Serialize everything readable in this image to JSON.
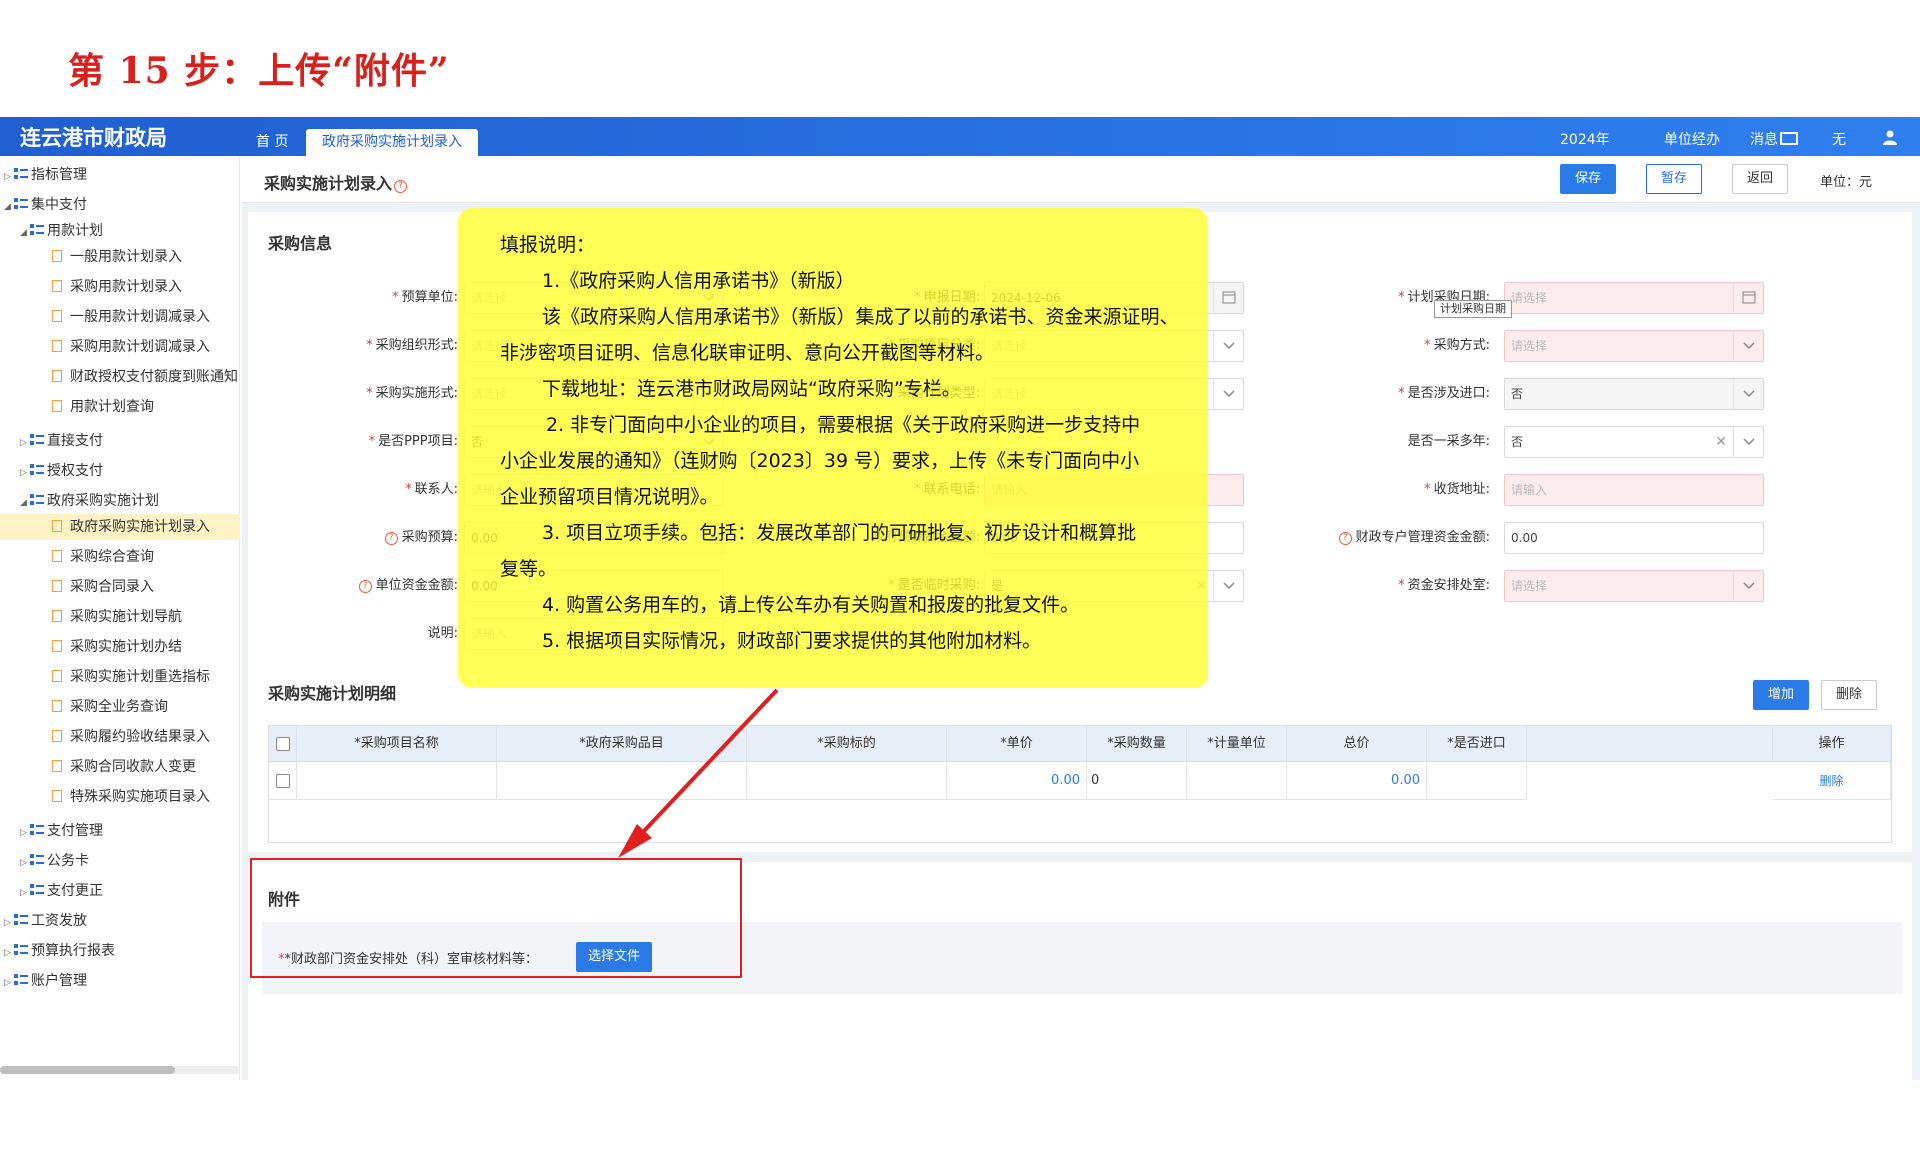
{
  "step_title": "第 15 步：上传“附件”",
  "topbar": {
    "brand": "连云港市财政局",
    "tab_home": "首 页",
    "tab_active": "政府采购实施计划录入",
    "year": "2024年",
    "role": "单位经办",
    "msg": "消息",
    "none": "无"
  },
  "sidebar": {
    "items": [
      "指标管理",
      "集中支付",
      "用款计划",
      "一般用款计划录入",
      "采购用款计划录入",
      "一般用款计划调减录入",
      "采购用款计划调减录入",
      "财政授权支付额度到账通知",
      "用款计划查询",
      "直接支付",
      "授权支付",
      "政府采购实施计划",
      "政府采购实施计划录入",
      "采购综合查询",
      "采购合同录入",
      "采购实施计划导航",
      "采购实施计划办结",
      "采购实施计划重选指标",
      "采购全业务查询",
      "采购履约验收结果录入",
      "采购合同收款人变更",
      "特殊采购实施项目录入",
      "支付管理",
      "公务卡",
      "支付更正",
      "工资发放",
      "预算执行报表",
      "账户管理"
    ]
  },
  "page": {
    "title": "采购实施计划录入",
    "btn_save": "保存",
    "btn_temp": "暂存",
    "btn_back": "返回",
    "unit": "单位：元"
  },
  "info": {
    "title": "采购信息",
    "labels": {
      "budget_unit": "预算单位:",
      "report_date": "申报日期:",
      "plan_date": "计划采购日期:",
      "org_form": "采购组织形式:",
      "item_type": "采购项目分类:",
      "method": "采购方式:",
      "impl_form": "采购实施形式:",
      "plan_type": "采购计划类型:",
      "import": "是否涉及进口:",
      "ppp": "是否PPP项目:",
      "multi_year": "是否一采多年:",
      "contact": "联系人:",
      "contact_phone": "联系电话:",
      "delivery": "收货地址:",
      "budget": "采购预算:",
      "gov_budget": "政府预算资金金额:",
      "special_fund": "财政专户管理资金金额:",
      "self_fund": "单位资金金额:",
      "temp_purchase": "是否临时采购:",
      "fund_office": "资金安排处室:",
      "note": "说明:"
    },
    "values": {
      "report_date": "2024-12-06",
      "import": "否",
      "ppp": "否",
      "multi_year": "否",
      "budget": "0.00",
      "gov_budget": "0.00",
      "special_fund": "0.00",
      "self_fund": "0.00",
      "temp_purchase": "是"
    },
    "ph_select": "请选择",
    "ph_input": "请输入",
    "tooltip": "计划采购日期"
  },
  "detail": {
    "title": "采购实施计划明细",
    "btn_add": "增加",
    "btn_del": "删除",
    "cols": [
      "*采购项目名称",
      "*政府采购品目",
      "*采购标的",
      "*单价",
      "*采购数量",
      "*计量单位",
      "总价",
      "*是否进口",
      "操作"
    ],
    "row": {
      "price": "0.00",
      "qty": "0",
      "total": "0.00",
      "op": "删除"
    }
  },
  "attach": {
    "title": "附件",
    "label": "*财政部门资金安排处（科）室审核材料等：",
    "btn": "选择文件"
  },
  "note": {
    "lines": [
      "填报说明：",
      "1.《政府采购人信用承诺书》（新版）",
      "该《政府采购人信用承诺书》（新版）集成了以前的承诺书、资金来源证明、",
      "非涉密项目证明、信息化联审证明、意向公开截图等材料。",
      "下载地址：连云港市财政局网站“政府采购”专栏。",
      "2. 非专门面向中小企业的项目，需要根据《关于政府采购进一步支持中",
      "小企业发展的通知》（连财购〔2023〕39 号）要求，上传《未专门面向中小",
      "企业预留项目情况说明》。",
      "3. 项目立项手续。包括：发展改革部门的可研批复、初步设计和概算批",
      "复等。",
      "4. 购置公务用车的，请上传公车办有关购置和报废的批复文件。",
      "5. 根据项目实际情况，财政部门要求提供的其他附加材料。"
    ]
  },
  "colors": {
    "primary": "#2a7be8",
    "topbar": "#1f5fd1",
    "highlight": "#ffff28",
    "red": "#e02020"
  }
}
